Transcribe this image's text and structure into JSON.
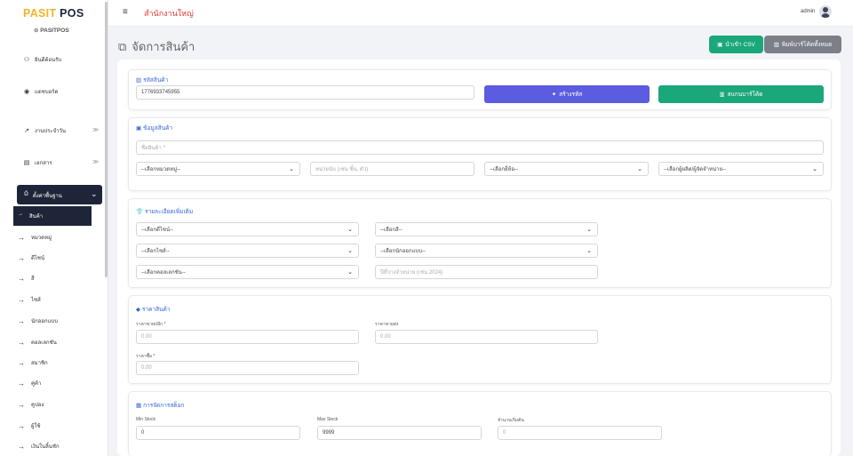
{
  "app": {
    "logo_part1": "PASIT",
    "logo_part2": "POS",
    "subtitle": "PASITPOS"
  },
  "sidebar": {
    "items": [
      {
        "label": "ยินดีต้อนรับ",
        "icon": "sitemap-icon"
      },
      {
        "label": "แดชบอร์ด",
        "icon": "dashboard-icon"
      },
      {
        "label": "งานประจำวัน",
        "icon": "chart-line-icon"
      },
      {
        "label": "เอกสาร",
        "icon": "file-icon"
      }
    ],
    "active_group": "ตั้งค่าพื้นฐาน",
    "sub_items": [
      "สินค้า",
      "หมวดหมู่",
      "ดีไซน์",
      "สี",
      "ไซส์",
      "นักออกแบบ",
      "คอลเลกชัน",
      "สมาชิก",
      "คู่ค้า",
      "คูปอง",
      "ผู้ใช้",
      "เงินในลิ้นชัก"
    ]
  },
  "topbar": {
    "branch": "สำนักงานใหญ่",
    "user": "admin"
  },
  "page": {
    "title": "จัดการสินค้า",
    "import_button": "นำเข้า CSV",
    "print_button": "พิมพ์บาร์โค้ดทั้งหมด"
  },
  "code_card": {
    "title": "รหัสสินค้า",
    "code_value": "1776933745955",
    "generate_button": "สร้างรหัส",
    "scan_button": "สแกนบาร์โค้ด"
  },
  "info_card": {
    "title": "ข้อมูลสินค้า",
    "name_placeholder": "ชื่อสินค้า *",
    "category_select": "--เลือกหมวดหมู่--",
    "unit_placeholder": "หน่วยนับ (เช่น ชิ้น, ตัว)",
    "brand_select": "--เลือกยี่ห้อ--",
    "supplier_select": "--เลือกผู้ผลิต/ผู้จัดจำหน่าย--"
  },
  "extra_card": {
    "title": "รายละเอียดเพิ่มเติม",
    "design_select": "--เลือกดีไซน์--",
    "color_select": "--เลือกสี--",
    "size_select": "--เลือกไซส์--",
    "designer_select": "--เลือกนักออกแบบ--",
    "collection_select": "--เลือกคอลเลกชัน--",
    "year_placeholder": "ปีที่วางจำหน่าย (เช่น 2024)"
  },
  "price_card": {
    "title": "ราคาสินค้า",
    "retail_label": "ราคาขายปลีก *",
    "retail_value": "0.00",
    "wholesale_label": "ราคาขายส่ง",
    "wholesale_value": "0.00",
    "cost_label": "ราคาซื้อ *",
    "cost_value": "0.00"
  },
  "stock_card": {
    "title": "การจัดการสต็อก",
    "min_label": "Min Stock",
    "min_value": "0",
    "max_label": "Max Stock",
    "max_value": "9999",
    "initial_label": "จำนวนเริ่มต้น",
    "initial_value": "0"
  },
  "colors": {
    "brand_yellow": "#f0b429",
    "dark": "#1e2538",
    "accent_blue": "#3a66d8",
    "danger": "#e23434",
    "green": "#1aa77a",
    "purple": "#5b5ce0"
  }
}
